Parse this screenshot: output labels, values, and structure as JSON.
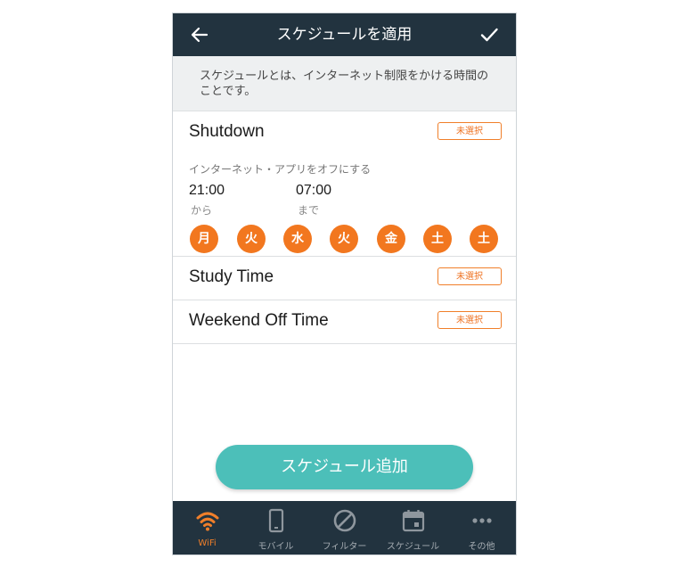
{
  "header": {
    "title": "スケジュールを適用"
  },
  "info": {
    "text": "スケジュールとは、インターネット制限をかける時間のことです。"
  },
  "schedules": [
    {
      "name": "Shutdown",
      "badge": "未選択",
      "description": "インターネット・アプリをオフにする",
      "start_time": "21:00",
      "start_label": "から",
      "end_time": "07:00",
      "end_label": "まで",
      "days": [
        "月",
        "火",
        "水",
        "火",
        "金",
        "土",
        "土"
      ]
    },
    {
      "name": "Study Time",
      "badge": "未選択"
    },
    {
      "name": "Weekend Off Time",
      "badge": "未選択"
    }
  ],
  "add_button": {
    "label": "スケジュール追加"
  },
  "nav": [
    {
      "label": "WiFi",
      "icon": "wifi-icon",
      "active": true
    },
    {
      "label": "モバイル",
      "icon": "mobile-icon",
      "active": false
    },
    {
      "label": "フィルター",
      "icon": "filter-icon",
      "active": false
    },
    {
      "label": "スケジュール",
      "icon": "calendar-icon",
      "active": false
    },
    {
      "label": "その他",
      "icon": "more-icon",
      "active": false
    }
  ],
  "colors": {
    "header": "#22333f",
    "accent": "#f2771f",
    "button": "#4cbfb9"
  }
}
